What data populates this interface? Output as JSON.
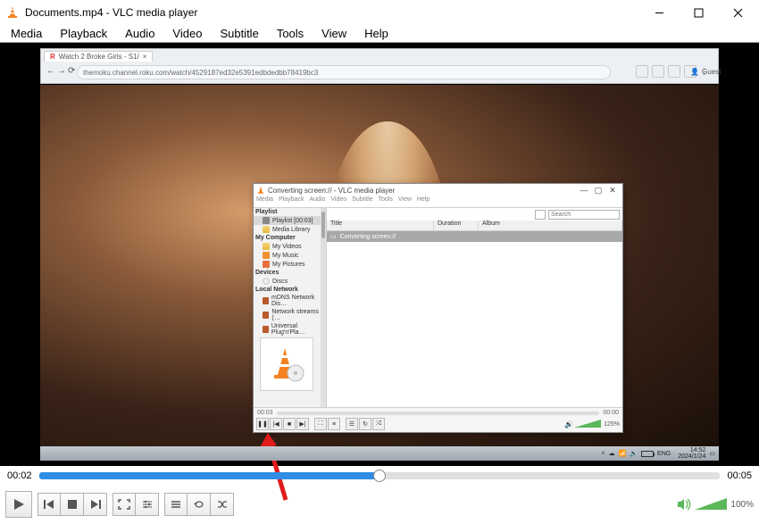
{
  "window": {
    "title": "Documents.mp4 - VLC media player",
    "min": "—",
    "max": "▢",
    "close": "✕"
  },
  "menu": [
    "Media",
    "Playback",
    "Audio",
    "Video",
    "Subtitle",
    "Tools",
    "View",
    "Help"
  ],
  "browser": {
    "tab_icon": "R",
    "tab_title": "Watch 2 Broke Girls - S1/",
    "tab_close": "×",
    "url": "themoku.channel.roku.com/watch/4529187ed32e5391edbdedbb78419bc3",
    "guest": "Guest"
  },
  "inner": {
    "title": "Converting screen:// - VLC media player",
    "menu": [
      "Media",
      "Playback",
      "Audio",
      "Video",
      "Subtitle",
      "Tools",
      "View",
      "Help"
    ],
    "sidebar": {
      "playlist_hdr": "Playlist",
      "playlist_item": "Playlist [00:03]",
      "media_library": "Media Library",
      "mycomputer_hdr": "My Computer",
      "my_videos": "My Videos",
      "my_music": "My Music",
      "my_pictures": "My Pictures",
      "devices_hdr": "Devices",
      "discs": "Discs",
      "localnet_hdr": "Local Network",
      "mdns": "mDNS Network Dis…",
      "streams": "Network streams (…",
      "upnp": "Universal Plug'n'Pla…"
    },
    "search_placeholder": "Search",
    "cols": {
      "title": "Title",
      "duration": "Duration",
      "album": "Album"
    },
    "row": "Converting screen://",
    "time_left": "00:03",
    "time_right": "00:00",
    "volume": "125%"
  },
  "tray": {
    "lang": "ENG",
    "time": "14:52",
    "date": "2024/1/24"
  },
  "outer": {
    "time_left": "00:02",
    "time_right": "00:05",
    "volume": "100%"
  }
}
